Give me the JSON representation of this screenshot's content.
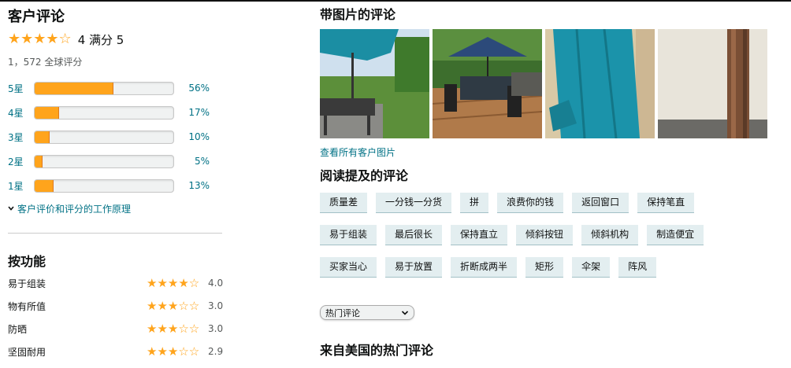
{
  "ratings": {
    "title": "客户评论",
    "average_text": "4 满分 5",
    "average_stars": 4,
    "global_count": "1，572 全球评分",
    "histogram": [
      {
        "label": "5星",
        "pct_text": "56%",
        "pct": 56
      },
      {
        "label": "4星",
        "pct_text": "17%",
        "pct": 17
      },
      {
        "label": "3星",
        "pct_text": "10%",
        "pct": 10
      },
      {
        "label": "2星",
        "pct_text": "5%",
        "pct": 5
      },
      {
        "label": "1星",
        "pct_text": "13%",
        "pct": 13
      }
    ],
    "how_it_works": "客户评价和评分的工作原理"
  },
  "features": {
    "title": "按功能",
    "items": [
      {
        "name": "易于组装",
        "value": "4.0",
        "stars": 4
      },
      {
        "name": "物有所值",
        "value": "3.0",
        "stars": 3
      },
      {
        "name": "防晒",
        "value": "3.0",
        "stars": 3
      },
      {
        "name": "坚固耐用",
        "value": "2.9",
        "stars": 3
      }
    ]
  },
  "photos": {
    "title": "带图片的评论",
    "see_all": "查看所有客户图片"
  },
  "mentions": {
    "title": "阅读提及的评论",
    "chips": [
      "质量差",
      "一分钱一分货",
      "拼",
      "浪费你的钱",
      "返回窗口",
      "保持笔直",
      "易于组装",
      "最后很长",
      "保持直立",
      "倾斜按钮",
      "倾斜机构",
      "制造便宜",
      "买家当心",
      "易于放置",
      "折断成两半",
      "矩形",
      "伞架",
      "阵风"
    ]
  },
  "sort": {
    "selected": "热门评论"
  },
  "top_reviews_title": "来自美国的热门评论",
  "colors": {
    "accent": "#ffa41c",
    "link": "#007185",
    "chip_bg": "#e3eef0"
  }
}
